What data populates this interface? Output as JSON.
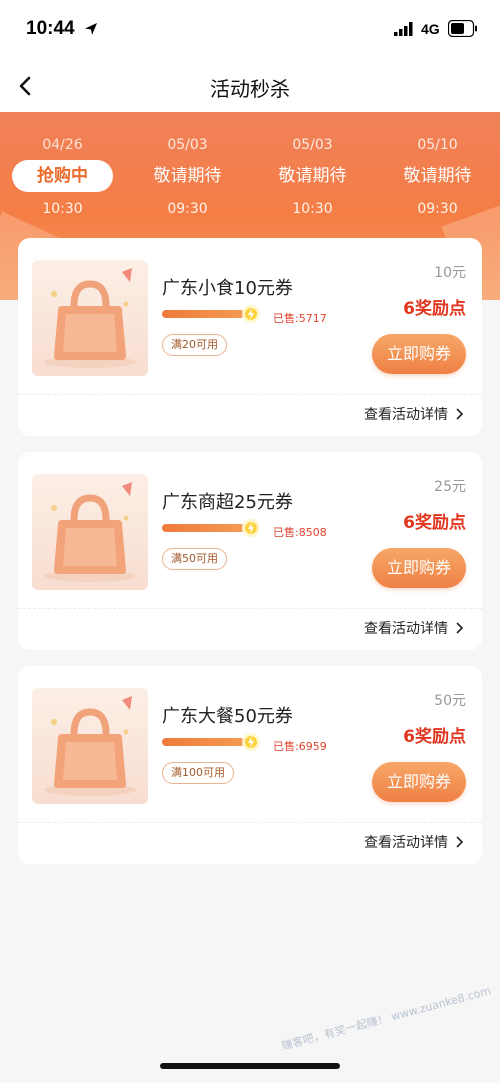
{
  "status_bar": {
    "time": "10:44",
    "network": "4G"
  },
  "nav": {
    "title": "活动秒杀"
  },
  "tabs": [
    {
      "date": "04/26",
      "status": "抢购中",
      "time": "10:30",
      "active": true
    },
    {
      "date": "05/03",
      "status": "敬请期待",
      "time": "09:30",
      "active": false
    },
    {
      "date": "05/03",
      "status": "敬请期待",
      "time": "10:30",
      "active": false
    },
    {
      "date": "05/10",
      "status": "敬请期待",
      "time": "09:30",
      "active": false
    }
  ],
  "colors": {
    "accent": "#ef8044",
    "points_red": "#e2361f",
    "band": "#f57e45"
  },
  "cards": [
    {
      "name": "广东小食10元券",
      "sold": "已售:5717",
      "progress": 0.85,
      "threshold": "满20可用",
      "face_value": "10元",
      "points": "6奖励点",
      "buy_label": "立即购券",
      "details_label": "查看活动详情"
    },
    {
      "name": "广东商超25元券",
      "sold": "已售:8508",
      "progress": 0.85,
      "threshold": "满50可用",
      "face_value": "25元",
      "points": "6奖励点",
      "buy_label": "立即购券",
      "details_label": "查看活动详情"
    },
    {
      "name": "广东大餐50元券",
      "sold": "已售:6959",
      "progress": 0.85,
      "threshold": "满100可用",
      "face_value": "50元",
      "points": "6奖励点",
      "buy_label": "立即购券",
      "details_label": "查看活动详情"
    }
  ],
  "watermark": "赚客吧，有奖一起赚！ www.zuanke8.com"
}
